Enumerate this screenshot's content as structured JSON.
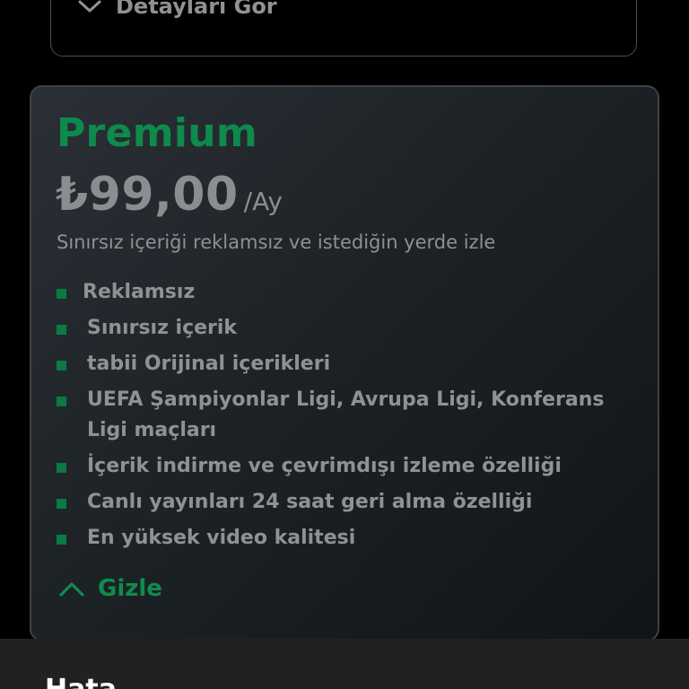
{
  "previous_plan": {
    "details_toggle_label": "Detayları Gör"
  },
  "plan": {
    "name": "Premium",
    "price": "₺99,00",
    "period": "/Ay",
    "description": "Sınırsız içeriği reklamsız ve istediğin yerde izle",
    "features": [
      "Reklamsız",
      "Sınırsız içerik",
      "tabii Orijinal içerikleri",
      "UEFA Şampiyonlar Ligi, Avrupa Ligi, Konferans Ligi maçları",
      "İçerik indirme ve çevrimdışı izleme özelliği",
      "Canlı yayınları 24 saat geri alma özelliği",
      "En yüksek video kalitesi"
    ],
    "hide_toggle_label": "Gizle"
  },
  "bottom_sheet": {
    "title": "Hata"
  },
  "colors": {
    "accent_green": "#0e8a4c",
    "muted_text": "#8f9295",
    "background": "#000000",
    "card_border": "#3d4247"
  },
  "icons": {
    "details_toggle": "chevron-down-icon",
    "hide_toggle": "chevron-up-icon",
    "feature_bullet": "square-bullet-icon"
  }
}
